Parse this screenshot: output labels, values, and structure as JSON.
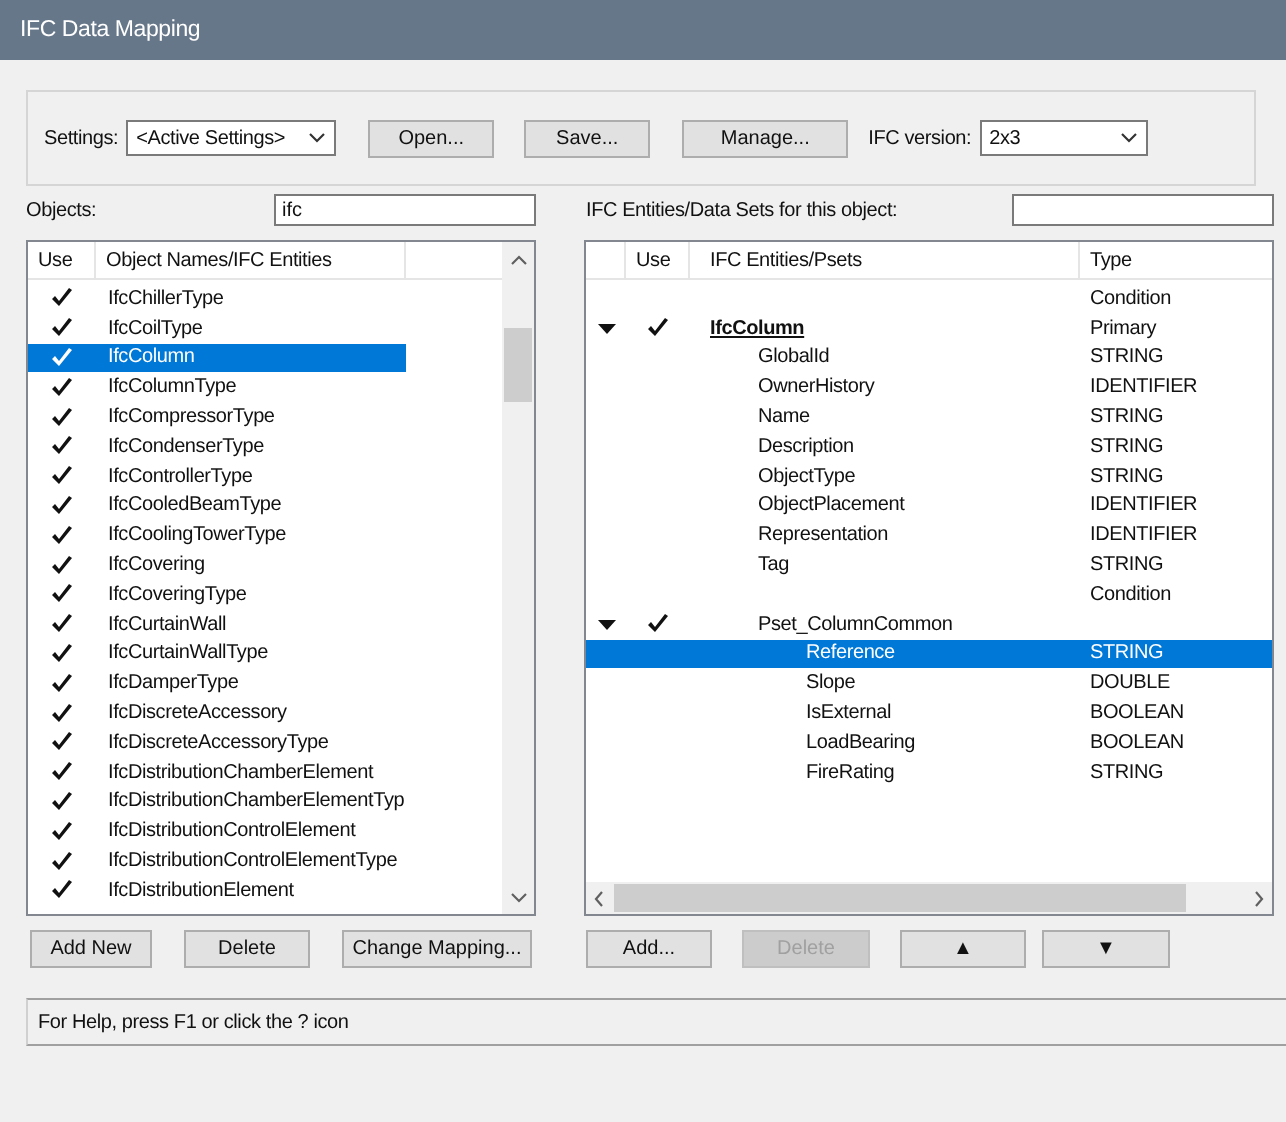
{
  "window": {
    "title": "IFC Data Mapping"
  },
  "settings": {
    "label": "Settings:",
    "value": "<Active Settings>",
    "buttons": [
      {
        "label": "Open..."
      },
      {
        "label": "Save..."
      },
      {
        "label": "Manage..."
      }
    ],
    "version_label": "IFC version:",
    "version_value": "2x3"
  },
  "objects": {
    "label": "Objects:",
    "filter": "ifc",
    "columns": [
      "Use",
      "Object Names/IFC Entities"
    ],
    "rows": [
      {
        "name": "IfcChillerType",
        "checked": true,
        "selected": false
      },
      {
        "name": "IfcCoilType",
        "checked": true,
        "selected": false
      },
      {
        "name": "IfcColumn",
        "checked": true,
        "selected": true
      },
      {
        "name": "IfcColumnType",
        "checked": true,
        "selected": false
      },
      {
        "name": "IfcCompressorType",
        "checked": true,
        "selected": false
      },
      {
        "name": "IfcCondenserType",
        "checked": true,
        "selected": false
      },
      {
        "name": "IfcControllerType",
        "checked": true,
        "selected": false
      },
      {
        "name": "IfcCooledBeamType",
        "checked": true,
        "selected": false
      },
      {
        "name": "IfcCoolingTowerType",
        "checked": true,
        "selected": false
      },
      {
        "name": "IfcCovering",
        "checked": true,
        "selected": false
      },
      {
        "name": "IfcCoveringType",
        "checked": true,
        "selected": false
      },
      {
        "name": "IfcCurtainWall",
        "checked": true,
        "selected": false
      },
      {
        "name": "IfcCurtainWallType",
        "checked": true,
        "selected": false
      },
      {
        "name": "IfcDamperType",
        "checked": true,
        "selected": false
      },
      {
        "name": "IfcDiscreteAccessory",
        "checked": true,
        "selected": false
      },
      {
        "name": "IfcDiscreteAccessoryType",
        "checked": true,
        "selected": false
      },
      {
        "name": "IfcDistributionChamberElement",
        "checked": true,
        "selected": false
      },
      {
        "name": "IfcDistributionChamberElementTyp",
        "checked": true,
        "selected": false
      },
      {
        "name": "IfcDistributionControlElement",
        "checked": true,
        "selected": false
      },
      {
        "name": "IfcDistributionControlElementType",
        "checked": true,
        "selected": false
      },
      {
        "name": "IfcDistributionElement",
        "checked": true,
        "selected": false
      }
    ],
    "buttons": [
      {
        "label": "Add New",
        "disabled": false
      },
      {
        "label": "Delete",
        "disabled": false
      },
      {
        "label": "Change Mapping...",
        "disabled": false
      }
    ]
  },
  "entities": {
    "label": "IFC Entities/Data Sets for this object:",
    "columns": [
      "Use",
      "IFC Entities/Psets",
      "Type"
    ],
    "tree": [
      {
        "type": "Condition",
        "selected": false
      },
      {
        "kind": "entity",
        "name": "IfcColumn",
        "type": "Primary",
        "expanded": true,
        "checked": true,
        "selected": false,
        "children": [
          {
            "name": "GlobalId",
            "type": "STRING",
            "selected": false
          },
          {
            "name": "OwnerHistory",
            "type": "IDENTIFIER",
            "selected": false
          },
          {
            "name": "Name",
            "type": "STRING",
            "selected": false
          },
          {
            "name": "Description",
            "type": "STRING",
            "selected": false
          },
          {
            "name": "ObjectType",
            "type": "STRING",
            "selected": false
          },
          {
            "name": "ObjectPlacement",
            "type": "IDENTIFIER",
            "selected": false
          },
          {
            "name": "Representation",
            "type": "IDENTIFIER",
            "selected": false
          },
          {
            "name": "Tag",
            "type": "STRING",
            "selected": false
          },
          {
            "type": "Condition",
            "selected": false
          },
          {
            "name": "Pset_ColumnCommon",
            "expanded": true,
            "checked": true,
            "selected": false,
            "children": [
              {
                "name": "Reference",
                "type": "STRING",
                "selected": true
              },
              {
                "name": "Slope",
                "type": "DOUBLE",
                "selected": false
              },
              {
                "name": "IsExternal",
                "type": "BOOLEAN",
                "selected": false
              },
              {
                "name": "LoadBearing",
                "type": "BOOLEAN",
                "selected": false
              },
              {
                "name": "FireRating",
                "type": "STRING",
                "selected": false
              }
            ]
          }
        ]
      }
    ],
    "buttons": [
      {
        "label": "Add...",
        "disabled": false
      },
      {
        "label": "Delete",
        "disabled": true
      },
      {
        "label": "▲",
        "disabled": false
      },
      {
        "label": "▼",
        "disabled": false
      }
    ]
  },
  "status_bar": {
    "text": "For Help, press F1 or click the ? icon"
  }
}
